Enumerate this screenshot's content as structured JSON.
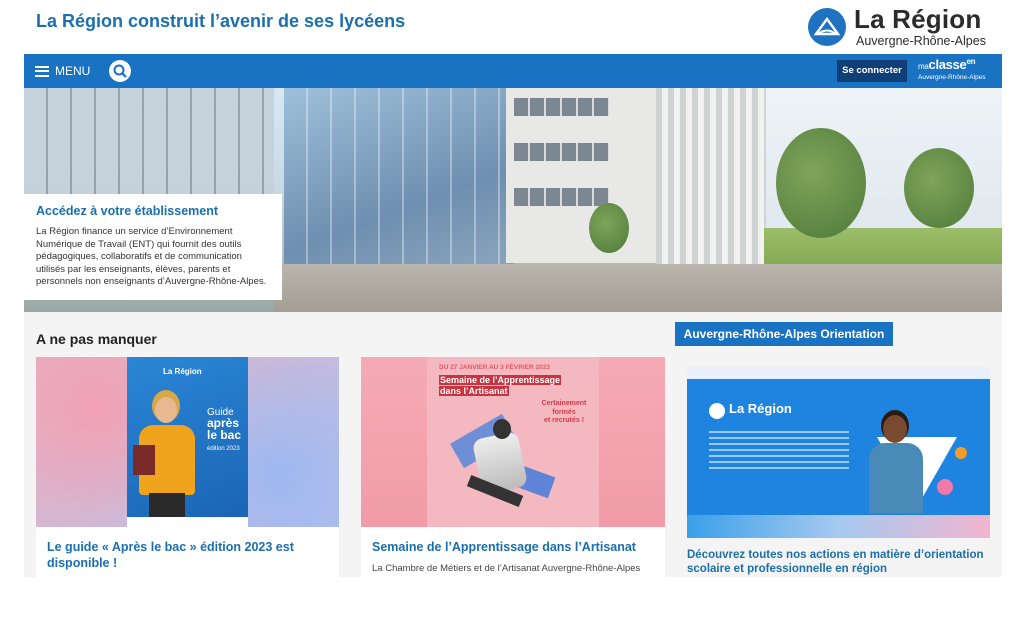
{
  "header": {
    "headline": "La Région construit l’avenir de ses lycéens",
    "logo_title": "La Région",
    "logo_subtitle": "Auvergne-Rhône-Alpes"
  },
  "nav": {
    "menu_label": "MENU",
    "login_label": "Se connecter",
    "maclasse_prefix": "ma",
    "maclasse_main": "classe",
    "maclasse_suffix": "en",
    "maclasse_sub": "Auvergne-Rhône-Alpes"
  },
  "hero": {
    "card_title": "Accédez à votre établissement",
    "card_text": "La Région finance un service d’Environnement Numérique de Travail (ENT) qui fournit des outils pédagogiques, collaboratifs et de communication utilisés par les enseignants, élèves, parents et personnels non enseignants d’Auvergne-Rhône-Alpes."
  },
  "section": {
    "title": "A ne pas manquer",
    "orientation_tag": "Auvergne-Rhône-Alpes Orientation"
  },
  "cards": [
    {
      "title": "Le guide « Après le bac » édition 2023 est disponible !",
      "text": "",
      "poster_logo": "La Région",
      "poster_guide": "Guide",
      "poster_guide_main": "après le bac",
      "poster_edition": "édition 2023"
    },
    {
      "title": "Semaine de l’Apprentissage dans l’Artisanat",
      "text": "La Chambre de Métiers et de l’Artisanat Auvergne-Rhône-Alpes",
      "poster_date": "DU 27 JANVIER AU 3 FÉVRIER 2023",
      "poster_title_a": "Semaine de l’Apprentissage",
      "poster_title_b": "dans l’Artisanat",
      "poster_side_a": "Certainement formés",
      "poster_side_b": "et recrutés !"
    },
    {
      "title": "Découvrez toutes nos actions en matière d’orientation scolaire et professionnelle en région",
      "text": "",
      "poster_logo": "La Région"
    }
  ],
  "colors": {
    "brand_blue": "#1a72c3",
    "title_blue": "#1a6fae",
    "dark_navy": "#0f3f76"
  },
  "icons": {
    "menu": "hamburger-icon",
    "search": "search-icon",
    "logo": "region-logo-icon"
  }
}
